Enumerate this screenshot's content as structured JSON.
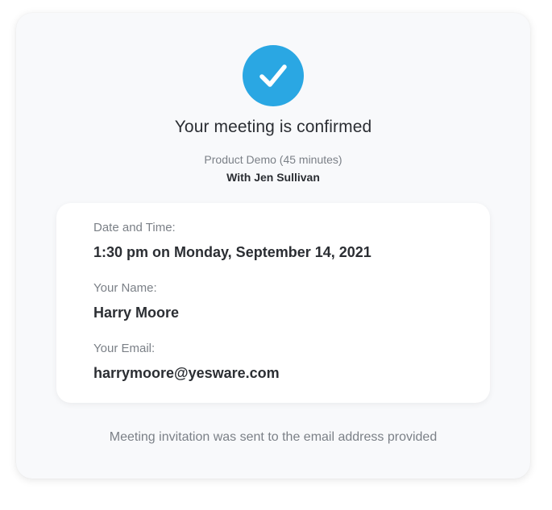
{
  "confirmation": {
    "title": "Your meeting is confirmed",
    "meeting_type": "Product Demo (45 minutes)",
    "host_line": "With Jen Sullivan",
    "icon": "checkmark-icon",
    "accent_color": "#2aa7e3"
  },
  "details": {
    "datetime_label": "Date and Time:",
    "datetime_value": "1:30 pm on Monday, September 14, 2021",
    "name_label": "Your Name:",
    "name_value": "Harry Moore",
    "email_label": "Your Email:",
    "email_value": "harrymoore@yesware.com"
  },
  "footer": {
    "note": "Meeting invitation was sent to the email address provided"
  }
}
